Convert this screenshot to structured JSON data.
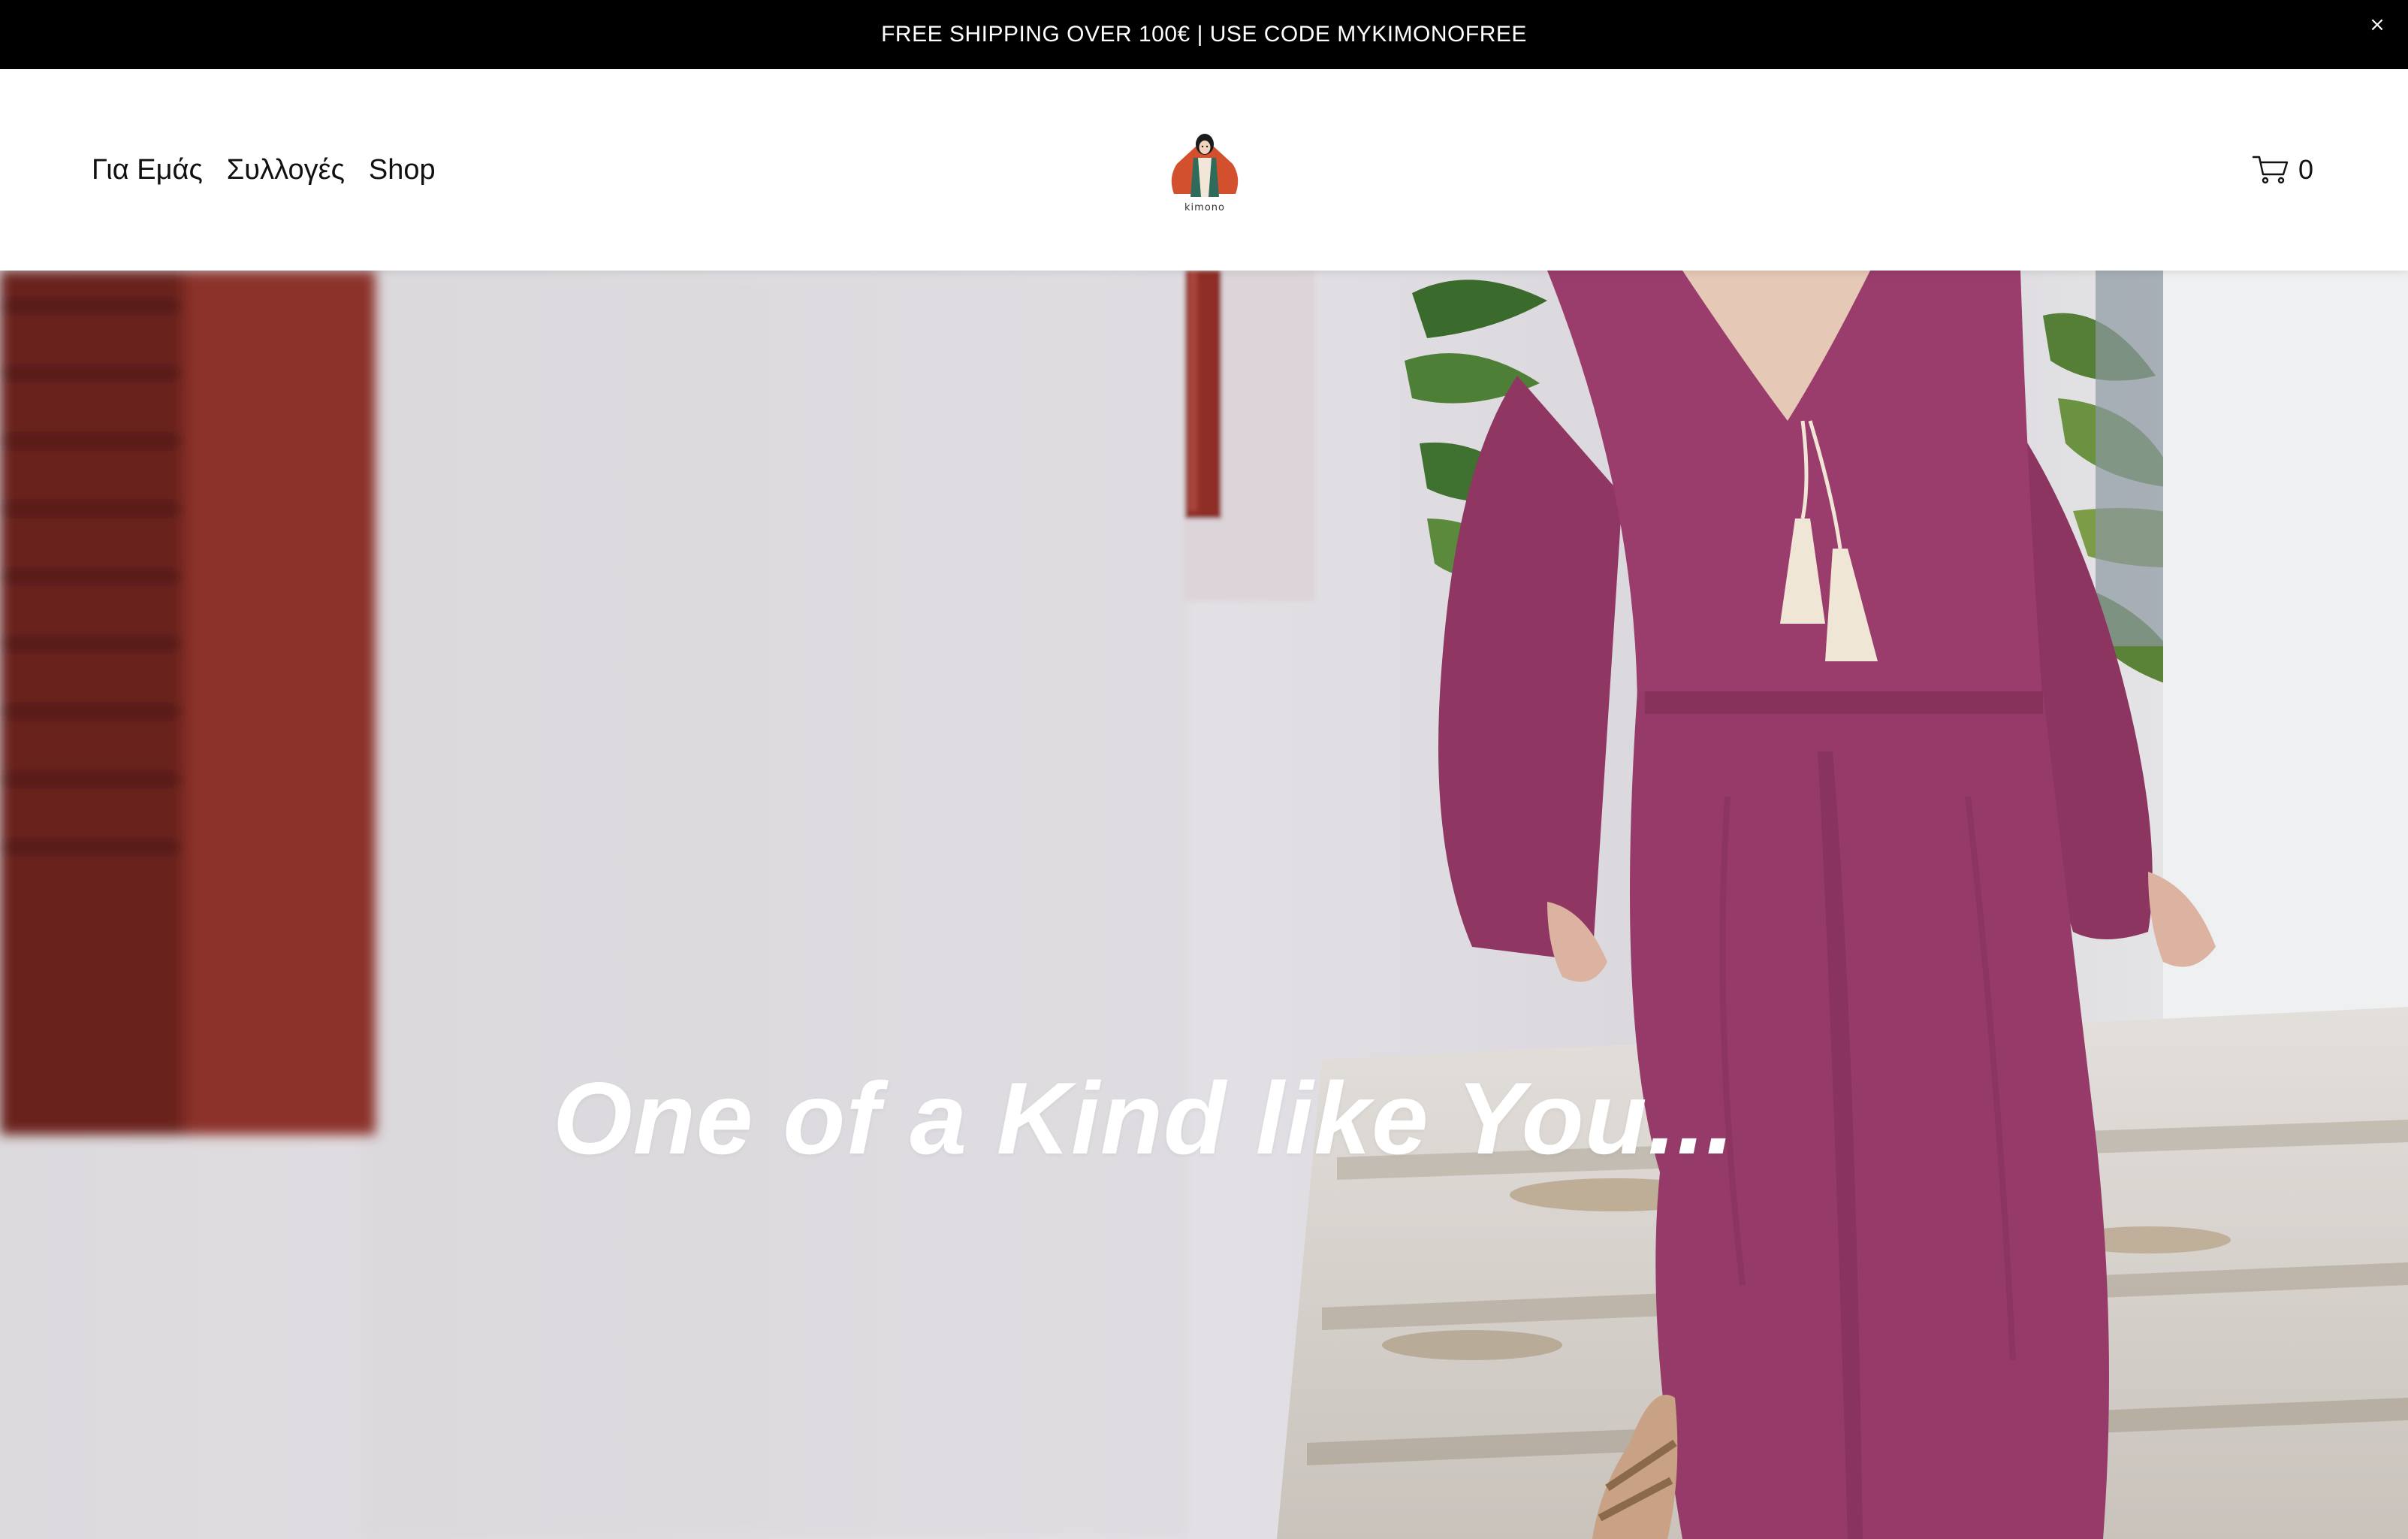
{
  "announcement": {
    "text": "FREE SHIPPING OVER 100€ | USE CODE MYKIMONOFREE",
    "close_symbol": "×"
  },
  "header": {
    "nav": [
      {
        "label": "Για Εμάς"
      },
      {
        "label": "Συλλογές"
      },
      {
        "label": "Shop"
      }
    ],
    "logo": {
      "text": "kimono"
    },
    "cart": {
      "icon": "cart-icon",
      "count": "0"
    }
  },
  "hero": {
    "heading": "One of a Kind like You..."
  },
  "colors": {
    "announcement_bg": "#000000",
    "header_bg": "#ffffff",
    "text": "#111111",
    "garment": "#9a3d6c",
    "shutter": "#7a2a22"
  }
}
